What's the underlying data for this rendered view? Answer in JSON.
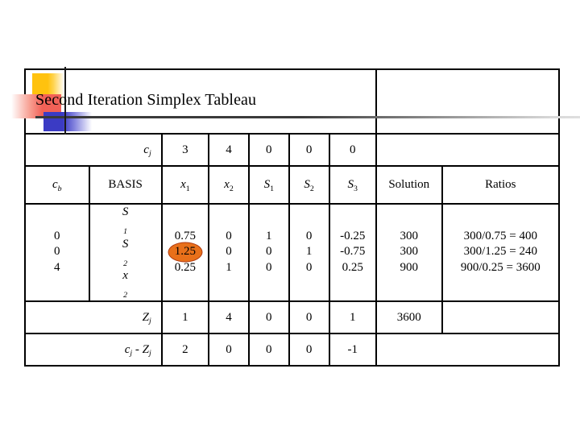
{
  "slide": {
    "title": "Second Iteration Simplex Tableau",
    "decoration": {
      "yellow": "#FFC20E",
      "red": "#F26157",
      "blue": "#3B3BC4",
      "rule": "#3A3A3A"
    }
  },
  "tableau": {
    "cj_row": {
      "label": "c",
      "label_sub": "j",
      "values": [
        "3",
        "4",
        "0",
        "0",
        "0"
      ]
    },
    "header_row": {
      "cb": "c",
      "cb_sub": "b",
      "basis": "BASIS",
      "columns": [
        {
          "name": "x",
          "sub": "1"
        },
        {
          "name": "x",
          "sub": "2"
        },
        {
          "name": "S",
          "sub": "1"
        },
        {
          "name": "S",
          "sub": "2"
        },
        {
          "name": "S",
          "sub": "3"
        }
      ],
      "solution": "Solution",
      "ratios": "Ratios"
    },
    "body_rows": [
      {
        "cb": "0",
        "basis": "S",
        "basis_sub": "1",
        "x1": "0.75",
        "x2": "0",
        "s1": "1",
        "s2": "0",
        "s3": "-0.25",
        "solution": "300",
        "ratio": "300/0.75 = 400",
        "pivot": false
      },
      {
        "cb": "0",
        "basis": "S",
        "basis_sub": "2",
        "x1": "1.25",
        "x2": "0",
        "s1": "0",
        "s2": "1",
        "s3": "-0.75",
        "solution": "300",
        "ratio": "300/1.25 = 240",
        "pivot": true
      },
      {
        "cb": "4",
        "basis": "x",
        "basis_sub": "2",
        "x1": "0.25",
        "x2": "1",
        "s1": "0",
        "s2": "0",
        "s3": "0.25",
        "solution": "900",
        "ratio": "900/0.25 = 3600",
        "pivot": false
      }
    ],
    "zj_row": {
      "label": "Z",
      "label_sub": "j",
      "values": [
        "1",
        "4",
        "0",
        "0",
        "1"
      ],
      "solution": "3600",
      "ratio": ""
    },
    "cjzj_row": {
      "label_c": "c",
      "label_c_sub": "j",
      "label_dash": " - ",
      "label_z": "Z",
      "label_z_sub": "j",
      "values": [
        "2",
        "0",
        "0",
        "0",
        "-1"
      ],
      "solution": "",
      "ratio": ""
    },
    "highlight": {
      "target": "1.25",
      "fill": "#E8701A",
      "stroke": "#B03A10"
    }
  }
}
